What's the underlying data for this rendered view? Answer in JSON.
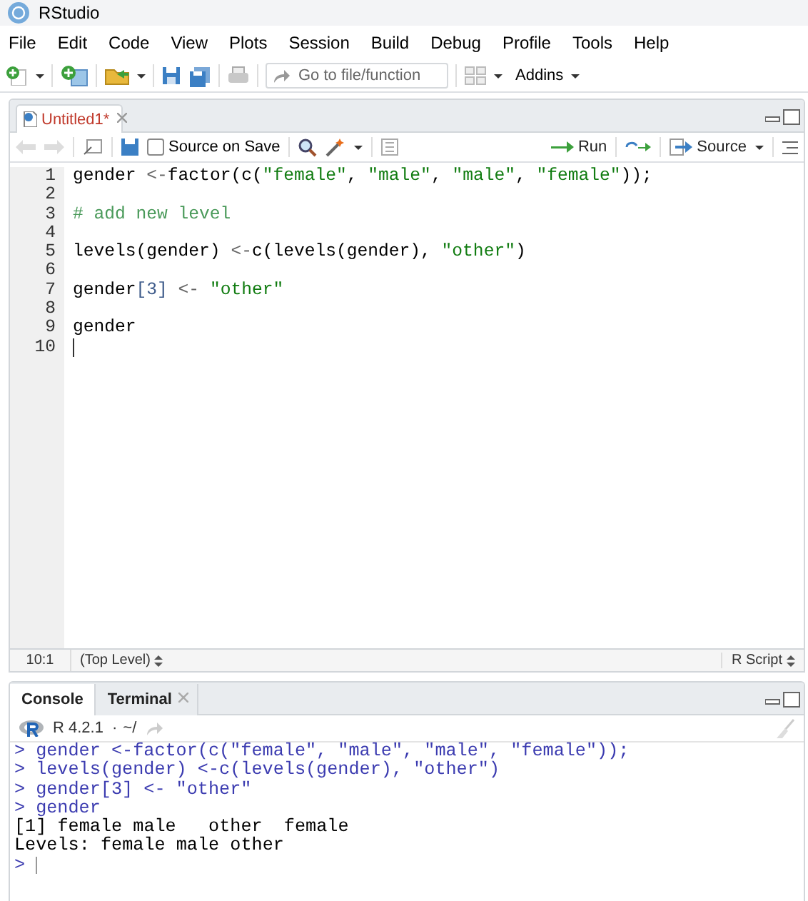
{
  "window": {
    "title": "RStudio"
  },
  "menu": [
    "File",
    "Edit",
    "Code",
    "View",
    "Plots",
    "Session",
    "Build",
    "Debug",
    "Profile",
    "Tools",
    "Help"
  ],
  "toolbar": {
    "goto_placeholder": "Go to file/function",
    "addins": "Addins"
  },
  "editor": {
    "tabs": [
      {
        "label": "Untitled1*",
        "selected": true,
        "modified": true
      }
    ],
    "source_on_save": {
      "label": "Source on Save",
      "checked": false
    },
    "run": "Run",
    "source": "Source",
    "lines": [
      {
        "number": "1",
        "tokens": [
          {
            "kind": "plain",
            "text": "gender "
          },
          {
            "kind": "op",
            "text": "<-"
          },
          {
            "kind": "plain",
            "text": "factor(c("
          },
          {
            "kind": "string",
            "text": "\"female\""
          },
          {
            "kind": "plain",
            "text": ", "
          },
          {
            "kind": "string",
            "text": "\"male\""
          },
          {
            "kind": "plain",
            "text": ", "
          },
          {
            "kind": "string",
            "text": "\"male\""
          },
          {
            "kind": "plain",
            "text": ", "
          },
          {
            "kind": "string",
            "text": "\"female\""
          },
          {
            "kind": "plain",
            "text": "));"
          }
        ]
      },
      {
        "number": "2"
      },
      {
        "number": "3",
        "tokens": [
          {
            "kind": "comment",
            "text": "# add new level"
          }
        ]
      },
      {
        "number": "4"
      },
      {
        "number": "5",
        "tokens": [
          {
            "kind": "plain",
            "text": "levels(gender) "
          },
          {
            "kind": "op",
            "text": "<-"
          },
          {
            "kind": "plain",
            "text": "c(levels(gender), "
          },
          {
            "kind": "string",
            "text": "\"other\""
          },
          {
            "kind": "plain",
            "text": ")"
          }
        ]
      },
      {
        "number": "6"
      },
      {
        "number": "7",
        "tokens": [
          {
            "kind": "plain",
            "text": "gender"
          },
          {
            "kind": "number",
            "text": "[3]"
          },
          {
            "kind": "op",
            "text": " <- "
          },
          {
            "kind": "string",
            "text": "\"other\""
          }
        ]
      },
      {
        "number": "8"
      },
      {
        "number": "9",
        "tokens": [
          {
            "kind": "plain",
            "text": "gender"
          }
        ]
      },
      {
        "number": "10",
        "cursor": true
      }
    ],
    "status": {
      "position": "10:1",
      "scope": "(Top Level)",
      "file_type": "R Script"
    }
  },
  "console": {
    "tabs": [
      {
        "label": "Console",
        "selected": true,
        "closable": false
      },
      {
        "label": "Terminal",
        "selected": false,
        "closable": true
      }
    ],
    "version": "R 4.2.1",
    "separator": "·",
    "path": "~/",
    "lines": [
      {
        "kind": "input",
        "prompt": ">",
        "text": "gender <-factor(c(\"female\", \"male\", \"male\", \"female\"));"
      },
      {
        "kind": "input",
        "prompt": ">",
        "text": "levels(gender) <-c(levels(gender), \"other\")"
      },
      {
        "kind": "input",
        "prompt": ">",
        "text": "gender[3] <- \"other\""
      },
      {
        "kind": "input",
        "prompt": ">",
        "text": "gender"
      },
      {
        "kind": "output",
        "text": "[1] female male   other  female"
      },
      {
        "kind": "output",
        "text": "Levels: female male other"
      },
      {
        "kind": "input",
        "prompt": ">",
        "cursor": true
      }
    ]
  }
}
